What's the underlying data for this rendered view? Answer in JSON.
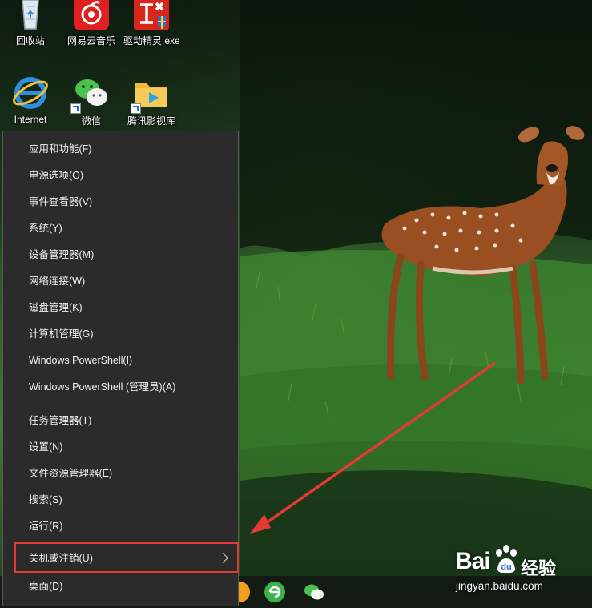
{
  "desktop": {
    "icons": [
      {
        "label": "回收站",
        "icon": "recycle-bin-icon"
      },
      {
        "label": "网易云音乐",
        "icon": "netease-music-icon"
      },
      {
        "label": "驱动精灵.exe",
        "icon": "driver-genius-icon"
      },
      {
        "label": "Internet",
        "icon": "internet-explorer-icon"
      },
      {
        "label": "微信",
        "icon": "wechat-icon"
      },
      {
        "label": "腾讯影视库",
        "icon": "tencent-video-folder-icon"
      }
    ]
  },
  "menu": {
    "group1": [
      "应用和功能(F)",
      "电源选项(O)",
      "事件查看器(V)",
      "系统(Y)",
      "设备管理器(M)",
      "网络连接(W)",
      "磁盘管理(K)",
      "计算机管理(G)",
      "Windows PowerShell(I)",
      "Windows PowerShell (管理员)(A)"
    ],
    "group2": [
      "任务管理器(T)",
      "设置(N)",
      "文件资源管理器(E)",
      "搜索(S)",
      "运行(R)"
    ],
    "group3": [
      "关机或注销(U)",
      "桌面(D)"
    ],
    "highlighted_item": "关机或注销(U)"
  },
  "taskbar": {
    "icons": [
      "browser-icon",
      "360-browser-icon",
      "wechat-icon"
    ]
  },
  "watermark": {
    "brand": "Bai",
    "text": "经验",
    "url": "jingyan.baidu.com"
  },
  "colors": {
    "menu_bg": "#2b2b2b",
    "menu_text": "#f2f2f2",
    "highlight": "#e53935",
    "arrow": "#e53935"
  }
}
